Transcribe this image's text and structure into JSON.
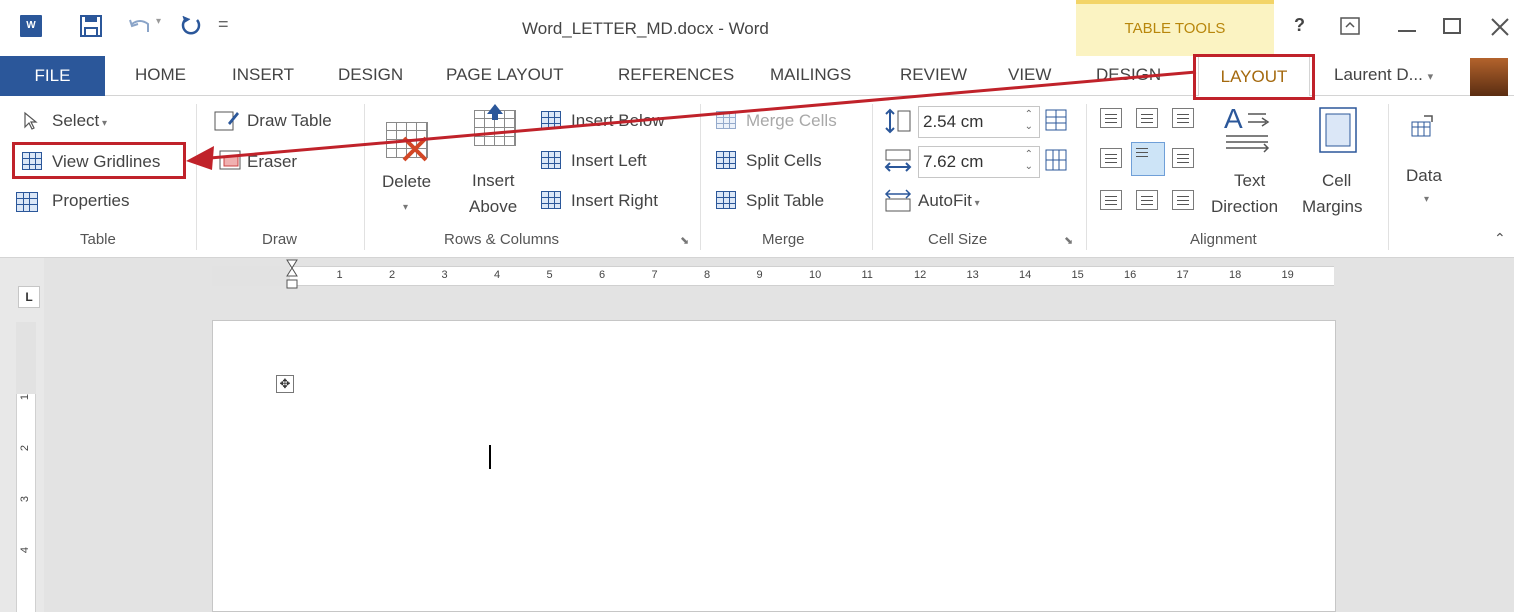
{
  "title_bar": {
    "app_icon_label": "W",
    "title": "Word_LETTER_MD.docx - Word",
    "contextual_group": "TABLE TOOLS",
    "help": "?",
    "qat_more": "="
  },
  "tabs": {
    "file": "FILE",
    "home": "HOME",
    "insert": "INSERT",
    "design": "DESIGN",
    "page_layout": "PAGE LAYOUT",
    "references": "REFERENCES",
    "mailings": "MAILINGS",
    "review": "REVIEW",
    "view": "VIEW",
    "table_design": "DESIGN",
    "table_layout": "LAYOUT"
  },
  "user": {
    "name": "Laurent D...",
    "menu_arrow": "▾"
  },
  "ribbon": {
    "table": {
      "label": "Table",
      "select": "Select",
      "view_gridlines": "View Gridlines",
      "properties": "Properties"
    },
    "draw": {
      "label": "Draw",
      "draw_table": "Draw Table",
      "eraser": "Eraser"
    },
    "rows_columns": {
      "label": "Rows & Columns",
      "delete": "Delete",
      "insert_above_1": "Insert",
      "insert_above_2": "Above",
      "insert_below": "Insert Below",
      "insert_left": "Insert Left",
      "insert_right": "Insert Right"
    },
    "merge": {
      "label": "Merge",
      "merge_cells": "Merge Cells",
      "split_cells": "Split Cells",
      "split_table": "Split Table"
    },
    "cell_size": {
      "label": "Cell Size",
      "height": "2.54 cm",
      "width": "7.62 cm",
      "autofit": "AutoFit"
    },
    "alignment": {
      "label": "Alignment",
      "text_direction_1": "Text",
      "text_direction_2": "Direction",
      "cell_margins_1": "Cell",
      "cell_margins_2": "Margins"
    },
    "data": {
      "label": "Data"
    }
  },
  "ruler": {
    "tab_selector": "L",
    "horizontal_numbers": [
      "1",
      "1",
      "1",
      "2",
      "3",
      "4",
      "5",
      "6",
      "7",
      "8",
      "9",
      "10",
      "11",
      "12",
      "13",
      "14",
      "15",
      "16",
      "17",
      "18",
      "19"
    ],
    "vertical_numbers": [
      "1",
      "1",
      "2",
      "3",
      "4"
    ]
  },
  "colors": {
    "word_blue": "#2b579a",
    "contextual_gold": "#f3d468",
    "annotation_red": "#c0222a"
  }
}
